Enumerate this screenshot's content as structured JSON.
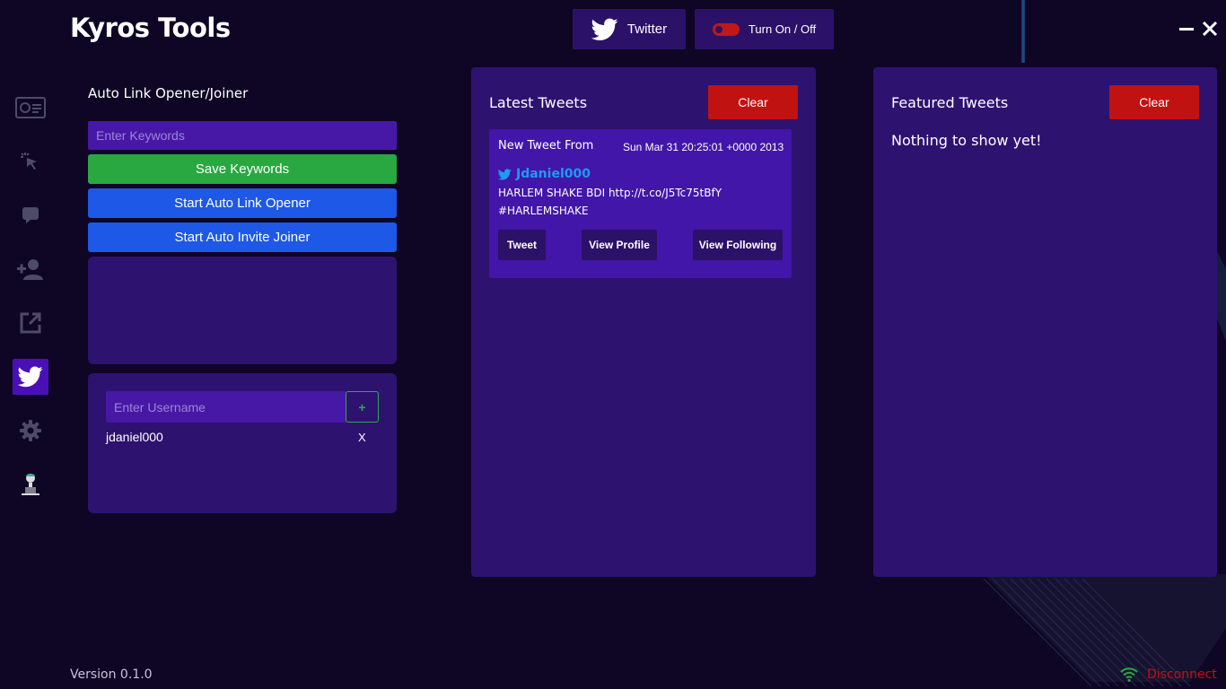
{
  "app": {
    "title": "Kyros Tools",
    "version": "Version 0.1.0"
  },
  "header": {
    "twitter_label": "Twitter",
    "toggle_label": "Turn On / Off"
  },
  "sidebar": {
    "items": [
      {
        "icon": "dashboard-icon",
        "active": false
      },
      {
        "icon": "cursor-click-icon",
        "active": false
      },
      {
        "icon": "chat-bubble-icon",
        "active": false
      },
      {
        "icon": "add-user-icon",
        "active": false
      },
      {
        "icon": "external-link-icon",
        "active": false
      },
      {
        "icon": "twitter-icon",
        "active": true
      },
      {
        "icon": "gear-icon",
        "active": false
      },
      {
        "icon": "user-laptop-icon",
        "active": false
      }
    ]
  },
  "left": {
    "title": "Auto Link Opener/Joiner",
    "keywords_placeholder": "Enter Keywords",
    "save_keywords": "Save Keywords",
    "start_link_opener": "Start Auto Link Opener",
    "start_invite_joiner": "Start Auto Invite Joiner",
    "username_placeholder": "Enter Username",
    "add_label": "+",
    "users": [
      {
        "name": "jdaniel000",
        "remove_label": "X"
      }
    ]
  },
  "latest": {
    "title": "Latest Tweets",
    "clear_label": "Clear",
    "tweet": {
      "heading": "New Tweet From",
      "timestamp": "Sun Mar 31 20:25:01 +0000 2013",
      "user": "Jdaniel000",
      "text_line1": "HARLEM SHAKE BDI http://t.co/J5Tc75tBfY",
      "text_line2": "#HARLEMSHAKE",
      "btn_tweet": "Tweet",
      "btn_profile": "View Profile",
      "btn_following": "View Following"
    }
  },
  "featured": {
    "title": "Featured Tweets",
    "clear_label": "Clear",
    "empty_message": "Nothing to show yet!"
  },
  "status": {
    "label": "Disconnect"
  },
  "colors": {
    "background": "#0e0624",
    "panel": "#2e1270",
    "input": "#4718a6",
    "accent_active": "#4a10b8",
    "green": "#29a842",
    "blue": "#1e58e6",
    "red": "#c11212",
    "twitter_blue": "#1d9bf0"
  }
}
